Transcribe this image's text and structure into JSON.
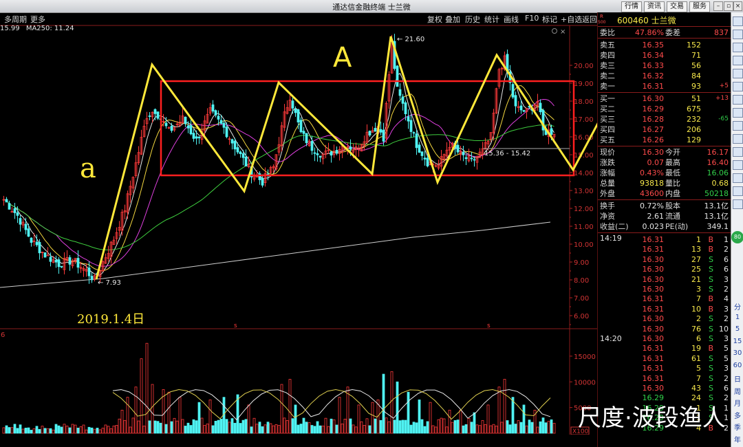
{
  "window": {
    "title": "通达信金融终端 士兰微",
    "top_buttons": [
      "行情",
      "资讯",
      "交易",
      "服务"
    ]
  },
  "toolbar": {
    "period": "多周期",
    "more": "更多",
    "tools": [
      "复权",
      "叠加",
      "历史",
      "统计",
      "画线",
      "F10",
      "标记",
      "+自选",
      "返回"
    ]
  },
  "ma_legend": {
    "first": "15.99",
    "second": "MA250: 11.24"
  },
  "chart": {
    "price_ticks": [
      "20.00",
      "19.00",
      "18.00",
      "17.00",
      "16.00",
      "15.00",
      "14.00",
      "13.00",
      "12.00",
      "11.00",
      "10.00",
      "9.00",
      "8.00",
      "7.00",
      "6.00"
    ],
    "vol_ticks": [
      "15000",
      "10000",
      "5000"
    ],
    "vol_unit": "X100",
    "vol_label": "6",
    "high_label": "21.60",
    "low_label": "7.93",
    "range_label": "15.36 - 15.42",
    "date_annotation": "2019.1.4日",
    "hand_a": "a",
    "hand_A": "A",
    "hand_b": "b",
    "s_marker": "s",
    "colors": {
      "up": "#ff3a3a",
      "down": "#4ff2f2",
      "yellow": "#ffe83a",
      "rect": "#ff1f1f",
      "ma_white": "#e8e8e8",
      "ma_yellow": "#f5d840",
      "ma_magenta": "#e040e0",
      "ma_green": "#3fcf3f",
      "ma_gray": "#cfcfcf"
    }
  },
  "quote": {
    "code": "600460",
    "name": "士兰微",
    "r_tag": "R",
    "num_tag": "500",
    "weibi_label": "委比",
    "weibi": "47.86%",
    "weicha_label": "委差",
    "weicha": "837",
    "asks": [
      {
        "label": "卖五",
        "price": "16.35",
        "vol": "152",
        "chg": ""
      },
      {
        "label": "卖四",
        "price": "16.34",
        "vol": "71",
        "chg": ""
      },
      {
        "label": "卖三",
        "price": "16.33",
        "vol": "56",
        "chg": ""
      },
      {
        "label": "卖二",
        "price": "16.32",
        "vol": "84",
        "chg": ""
      },
      {
        "label": "卖一",
        "price": "16.31",
        "vol": "93",
        "chg": "+5"
      }
    ],
    "bids": [
      {
        "label": "买一",
        "price": "16.30",
        "vol": "51",
        "chg": "+13"
      },
      {
        "label": "买二",
        "price": "16.29",
        "vol": "675",
        "chg": ""
      },
      {
        "label": "买三",
        "price": "16.28",
        "vol": "232",
        "chg": "-65"
      },
      {
        "label": "买四",
        "price": "16.27",
        "vol": "206",
        "chg": ""
      },
      {
        "label": "买五",
        "price": "16.26",
        "vol": "129",
        "chg": ""
      }
    ],
    "stats": [
      {
        "l1": "现价",
        "v1": "16.30",
        "l2": "今开",
        "v2": "16.17"
      },
      {
        "l1": "涨跌",
        "v1": "0.07",
        "l2": "最高",
        "v2": "16.40"
      },
      {
        "l1": "涨幅",
        "v1": "0.43%",
        "l2": "最低",
        "v2": "16.06"
      },
      {
        "l1": "总量",
        "v1": "93818",
        "l2": "量比",
        "v2": "0.68"
      },
      {
        "l1": "外盘",
        "v1": "43600",
        "l2": "内盘",
        "v2": "50218"
      }
    ],
    "stats2": [
      {
        "l1": "换手",
        "v1": "0.72%",
        "l2": "股本",
        "v2": "13.1亿"
      },
      {
        "l1": "净资",
        "v1": "2.61",
        "l2": "流通",
        "v2": "13.1亿"
      },
      {
        "l1": "收益(二)",
        "v1": "0.023",
        "l2": "PE(动)",
        "v2": "349.1"
      }
    ],
    "time1": "14:19",
    "time2": "14:20",
    "ticks": [
      {
        "p": "16.31",
        "v": "1",
        "s": "B",
        "n": "1"
      },
      {
        "p": "16.31",
        "v": "13",
        "s": "B",
        "n": "2"
      },
      {
        "p": "16.30",
        "v": "27",
        "s": "S",
        "n": "6"
      },
      {
        "p": "16.30",
        "v": "25",
        "s": "S",
        "n": "6"
      },
      {
        "p": "16.30",
        "v": "21",
        "s": "S",
        "n": "3"
      },
      {
        "p": "16.30",
        "v": "3",
        "s": "S",
        "n": "2"
      },
      {
        "p": "16.31",
        "v": "7",
        "s": "B",
        "n": "4"
      },
      {
        "p": "16.31",
        "v": "10",
        "s": "B",
        "n": "3"
      },
      {
        "p": "16.30",
        "v": "2",
        "s": "S",
        "n": "2"
      },
      {
        "p": "16.30",
        "v": "76",
        "s": "S",
        "n": "10"
      },
      {
        "p": "16.30",
        "v": "6",
        "s": "S",
        "n": "3"
      },
      {
        "p": "16.31",
        "v": "19",
        "s": "B",
        "n": "5"
      },
      {
        "p": "16.31",
        "v": "61",
        "s": "S",
        "n": "5"
      },
      {
        "p": "16.31",
        "v": "5",
        "s": "S",
        "n": "3"
      },
      {
        "p": "16.31",
        "v": "7",
        "s": "S",
        "n": "2"
      },
      {
        "p": "16.30",
        "v": "43",
        "s": "S",
        "n": "6"
      },
      {
        "p": "16.29",
        "v": "24",
        "s": "S",
        "n": "2"
      },
      {
        "p": "16.29",
        "v": "1",
        "s": "S",
        "n": "1"
      },
      {
        "p": "16.29",
        "v": "1",
        "s": "S",
        "n": "1"
      },
      {
        "p": "16.29",
        "v": "4",
        "s": "B",
        "n": "2"
      }
    ]
  },
  "sidebar": {
    "icons": [
      "chart-icon",
      "arrow-icon",
      "bars-icon",
      "list-icon",
      "window-icon",
      "line-icon",
      "grid-icon",
      "table-icon",
      "doc-icon",
      "calc-icon",
      "f10-icon",
      "news-icon",
      "rsi-icon",
      "gear-icon",
      "refresh-icon"
    ],
    "labels": [
      "分",
      "1",
      "5",
      "15",
      "30",
      "60",
      "日",
      "周",
      "月",
      "多",
      "季",
      "年"
    ]
  },
  "watermark": "尺度·波段渔人"
}
